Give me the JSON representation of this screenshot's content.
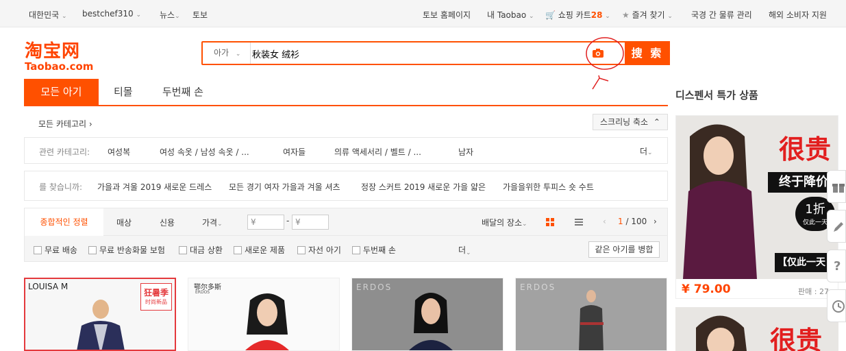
{
  "topbar": {
    "region": "대한민국",
    "user": "bestchef310",
    "news": "뉴스",
    "tobo": "토보",
    "home": "토보 홈페이지",
    "my_taobao": "내 Taobao",
    "cart_label": "쇼핑 카트",
    "cart_count": "28",
    "favorites": "즐겨 찾기",
    "logistics": "국경 간 물류 관리",
    "overseas": "해외 소비자 지원"
  },
  "logo": {
    "cn": "淘宝网",
    "en": "Taobao.com"
  },
  "search": {
    "scope": "아가",
    "value": "秋装女 绒衫",
    "button": "搜 索"
  },
  "tabs": [
    "모든 아기",
    "티몰",
    "두번째 손"
  ],
  "category": {
    "all_label": "모든 카테고리",
    "shrink_label": "스크리닝 축소",
    "related_label": "관련 카테고리:",
    "related_items": [
      "여성복",
      "여성 속옷 / 남성 속옷 / ...",
      "여자들",
      "의류 액세서리 / 벨트 / ...",
      "남자"
    ],
    "more": "더",
    "find_label": "를 찾습니까:",
    "suggestions": [
      "가을과 겨울 2019 새로운 드레스",
      "모든 경기 여자 가을과 겨울 셔츠",
      "정장 스커트 2019 새로운 가을 얇은",
      "가을을위한 투피스 숏 수트"
    ]
  },
  "sort": {
    "comprehensive": "종합적인 정렬",
    "sales": "매상",
    "credit": "신용",
    "price": "가격",
    "price_min": "¥",
    "price_max": "¥",
    "dash": "-",
    "shipping_place": "배달의 장소",
    "page_current": "1",
    "page_total": "/ 100"
  },
  "filters": {
    "items": [
      "무료 배송",
      "무료 반송화물 보험",
      "대금 상환",
      "새로운 제품",
      "자선 아기",
      "두번째 손"
    ],
    "more": "더",
    "merge": "같은 아기를 병합"
  },
  "products": [
    {
      "brand": "LOUISA M",
      "badge": "狂暑季",
      "badge_sub": "时尚新品",
      "bg": "#f7f7f7",
      "border": "#e4393c"
    },
    {
      "brand": "鄂尔多斯",
      "brand_sub": "ERDOS",
      "bg": "#fafafa",
      "border": "#eeeeee"
    },
    {
      "brand": "ERDOS",
      "bg": "#8e8e8e",
      "border": "#eeeeee"
    },
    {
      "brand": "ERDOS",
      "bg": "#a2a2a2",
      "border": "#eeeeee"
    }
  ],
  "sidebar": {
    "title": "디스펜서 특가 상품",
    "ad1": {
      "title": "很贵",
      "banner": "终于降价",
      "discount": "1折",
      "discount_sub": "仅此一天",
      "bottom": "【仅此一天",
      "price": "¥ 79.00",
      "sales_label": "판매 : 27"
    },
    "ad2": {
      "title": "很贵"
    }
  },
  "colors": {
    "accent": "#ff5000",
    "price": "#ff4400"
  }
}
